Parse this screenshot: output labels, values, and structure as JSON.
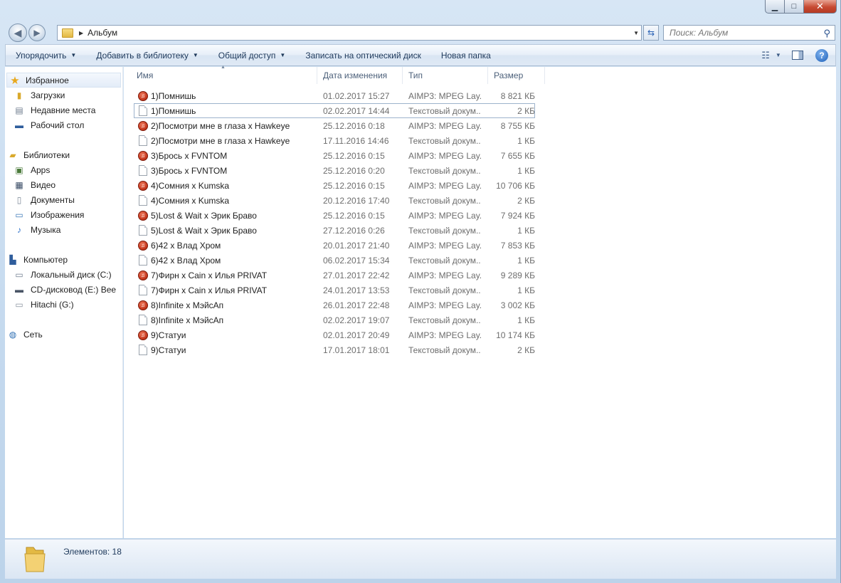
{
  "window": {
    "controls": {
      "minimize": "▁",
      "maximize": "□",
      "close": "✕"
    }
  },
  "address": {
    "path": "Альбум",
    "search_placeholder": "Поиск: Альбум"
  },
  "toolbar": {
    "organize": "Упорядочить",
    "add_to_library": "Добавить в библиотеку",
    "share": "Общий доступ",
    "burn": "Записать на оптический диск",
    "new_folder": "Новая папка"
  },
  "nav": {
    "favorites": {
      "label": "Избранное",
      "items": [
        "Загрузки",
        "Недавние места",
        "Рабочий стол"
      ]
    },
    "libraries": {
      "label": "Библиотеки",
      "items": [
        "Apps",
        "Видео",
        "Документы",
        "Изображения",
        "Музыка"
      ]
    },
    "computer": {
      "label": "Компьютер",
      "items": [
        "Локальный диск (C:)",
        "CD-дисковод (E:) Bee",
        "Hitachi (G:)"
      ]
    },
    "network": {
      "label": "Сеть"
    }
  },
  "columns": {
    "name": "Имя",
    "date": "Дата изменения",
    "type": "Тип",
    "size": "Размер"
  },
  "files": [
    {
      "name": "1)Помнишь",
      "date": "01.02.2017 15:27",
      "type": "AIMP3: MPEG Lay...",
      "size": "8 821 КБ",
      "kind": "mp3"
    },
    {
      "name": "1)Помнишь",
      "date": "02.02.2017 14:44",
      "type": "Текстовый докум...",
      "size": "2 КБ",
      "kind": "txt"
    },
    {
      "name": "2)Посмотри мне в глаза x Hawkeye",
      "date": "25.12.2016 0:18",
      "type": "AIMP3: MPEG Lay...",
      "size": "8 755 КБ",
      "kind": "mp3"
    },
    {
      "name": "2)Посмотри мне в глаза x Hawkeye",
      "date": "17.11.2016 14:46",
      "type": "Текстовый докум...",
      "size": "1 КБ",
      "kind": "txt"
    },
    {
      "name": "3)Брось x FVNTOM",
      "date": "25.12.2016 0:15",
      "type": "AIMP3: MPEG Lay...",
      "size": "7 655 КБ",
      "kind": "mp3"
    },
    {
      "name": "3)Брось x FVNTOM",
      "date": "25.12.2016 0:20",
      "type": "Текстовый докум...",
      "size": "1 КБ",
      "kind": "txt"
    },
    {
      "name": "4)Сомния x Kumska",
      "date": "25.12.2016 0:15",
      "type": "AIMP3: MPEG Lay...",
      "size": "10 706 КБ",
      "kind": "mp3"
    },
    {
      "name": "4)Сомния x Kumska",
      "date": "20.12.2016 17:40",
      "type": "Текстовый докум...",
      "size": "2 КБ",
      "kind": "txt"
    },
    {
      "name": "5)Lost & Wait x Эрик Браво",
      "date": "25.12.2016 0:15",
      "type": "AIMP3: MPEG Lay...",
      "size": "7 924 КБ",
      "kind": "mp3"
    },
    {
      "name": "5)Lost & Wait x Эрик Браво",
      "date": "27.12.2016 0:26",
      "type": "Текстовый докум...",
      "size": "1 КБ",
      "kind": "txt"
    },
    {
      "name": "6)42 x Влад Хром",
      "date": "20.01.2017 21:40",
      "type": "AIMP3: MPEG Lay...",
      "size": "7 853 КБ",
      "kind": "mp3"
    },
    {
      "name": "6)42 x Влад Хром",
      "date": "06.02.2017 15:34",
      "type": "Текстовый докум...",
      "size": "1 КБ",
      "kind": "txt"
    },
    {
      "name": "7)Фирн x Cain x Илья PRIVAT",
      "date": "27.01.2017 22:42",
      "type": "AIMP3: MPEG Lay...",
      "size": "9 289 КБ",
      "kind": "mp3"
    },
    {
      "name": "7)Фирн x Cain x Илья PRIVAT",
      "date": "24.01.2017 13:53",
      "type": "Текстовый докум...",
      "size": "1 КБ",
      "kind": "txt"
    },
    {
      "name": "8)Infinite x МэйсАп",
      "date": "26.01.2017 22:48",
      "type": "AIMP3: MPEG Lay...",
      "size": "3 002 КБ",
      "kind": "mp3"
    },
    {
      "name": "8)Infinite x МэйсАп",
      "date": "02.02.2017 19:07",
      "type": "Текстовый докум...",
      "size": "1 КБ",
      "kind": "txt"
    },
    {
      "name": "9)Статуи",
      "date": "02.01.2017 20:49",
      "type": "AIMP3: MPEG Lay...",
      "size": "10 174 КБ",
      "kind": "mp3"
    },
    {
      "name": "9)Статуи",
      "date": "17.01.2017 18:01",
      "type": "Текстовый докум...",
      "size": "2 КБ",
      "kind": "txt"
    }
  ],
  "status": {
    "text": "Элементов: 18"
  }
}
